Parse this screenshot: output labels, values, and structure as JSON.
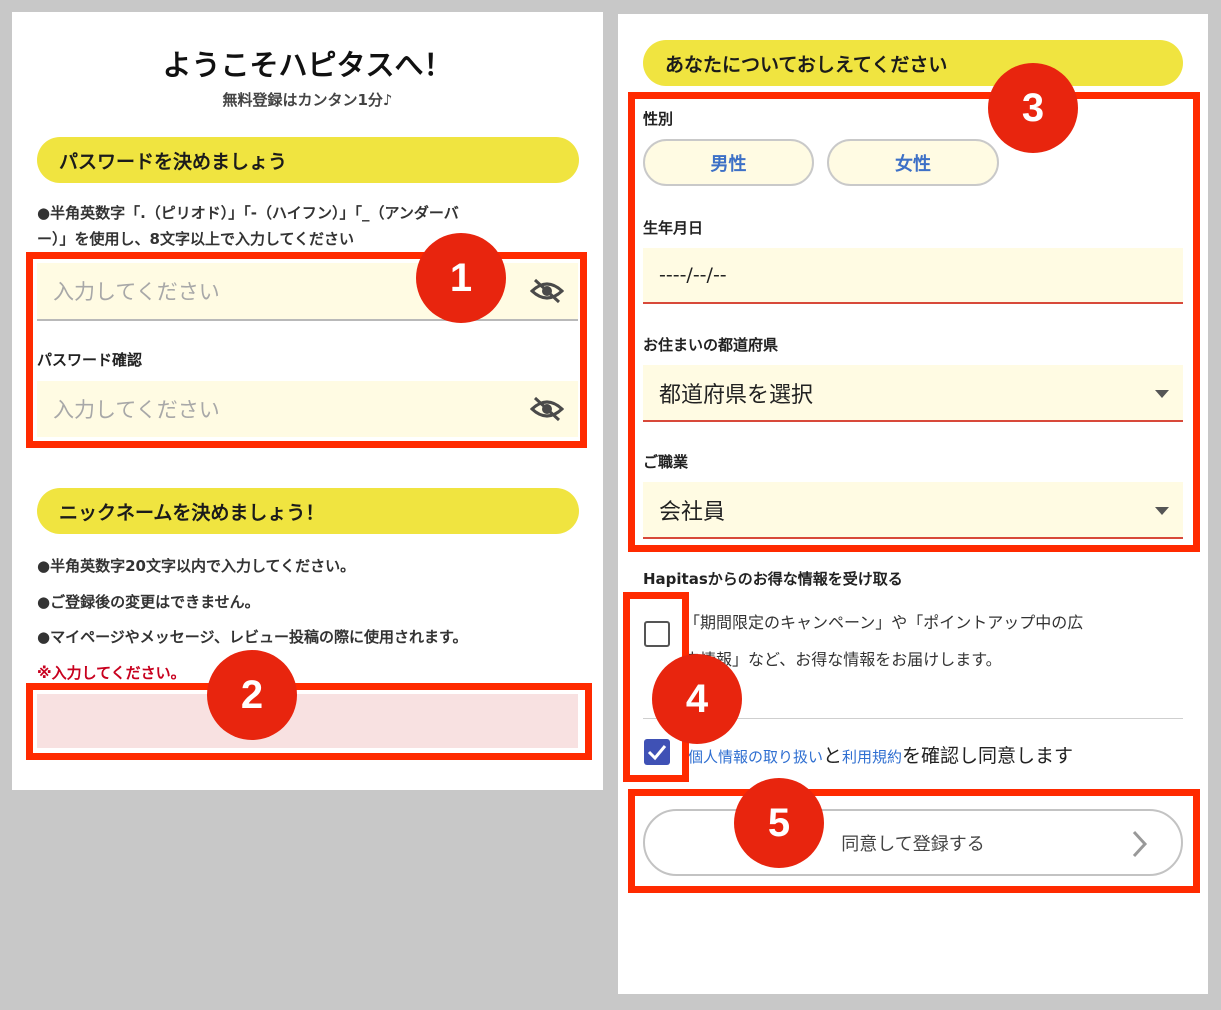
{
  "left": {
    "title": "ようこそハピタスへ！",
    "subtitle": "無料登録はカンタン1分♪",
    "password_section": {
      "heading": "パスワードを決めましょう",
      "note_line1": "●半角英数字「.（ピリオド）」「-（ハイフン）」「_（アンダーバ",
      "note_line2": "ー）」を使用し、8文字以上で入力してください",
      "password_placeholder": "入力してください",
      "confirm_label": "パスワード確認",
      "confirm_placeholder": "入力してください"
    },
    "nickname_section": {
      "heading": "ニックネームを決めましょう！",
      "note1": "●半角英数字20文字以内で入力してください。",
      "note2": "●ご登録後の変更はできません。",
      "note3": "●マイページやメッセージ、レビュー投稿の際に使用されます。",
      "error": "※入力してください。"
    }
  },
  "right": {
    "heading": "あなたについておしえてください",
    "gender_label": "性別",
    "male": "男性",
    "female": "女性",
    "birth_label": "生年月日",
    "birth_value": "----/--/--",
    "prefecture_label": "お住まいの都道府県",
    "prefecture_value": "都道府県を選択",
    "occupation_label": "ご職業",
    "occupation_value": "会社員",
    "newsletter_label": "Hapitasからのお得な情報を受け取る",
    "newsletter_line1": "「期間限定のキャンペーン」や「ポイントアップ中の広",
    "newsletter_line2": "告情報」など、お得な情報をお届けします。",
    "privacy_link": "個人情報の取り扱い",
    "and_text": "と",
    "terms_link": "利用規約",
    "agree_text": "を確認し同意します",
    "submit_label": "同意して登録する"
  },
  "badges": [
    "1",
    "2",
    "3",
    "4",
    "5"
  ],
  "colors": {
    "highlight": "#ff2a00",
    "badge": "#e8250e",
    "pill": "#f0e440",
    "field_bg": "#fffbe3",
    "error": "#c8001e",
    "checkbox": "#3f51b5"
  }
}
